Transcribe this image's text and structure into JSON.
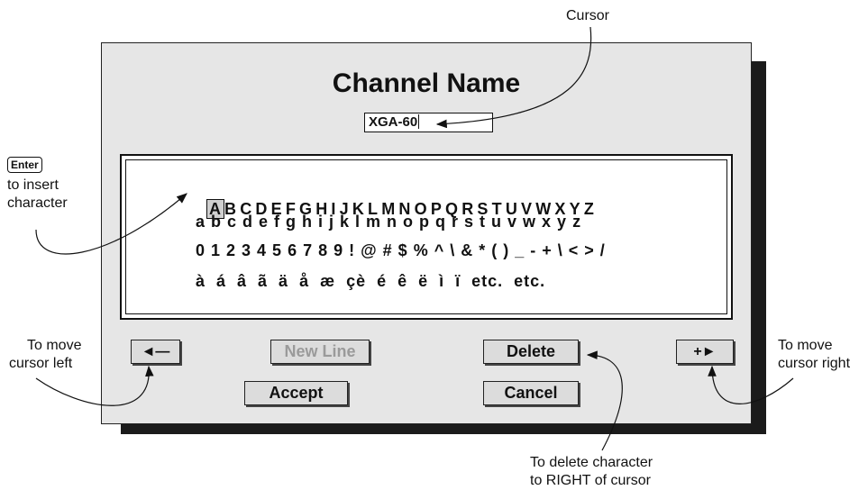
{
  "dialog": {
    "title": "Channel Name",
    "name_value": "XGA-60",
    "highlighted_char": "A",
    "rows": [
      "BCDEFGHIJKLMNOPQRSTUVWXYZ",
      "a b c d e f g h i j k l m n o p q r s t u v w x y z",
      "0 1 2 3 4 5 6 7 8 9 ! @ # $ % ^ \\ & * ( ) _ - + \\ < > /",
      "à  á  â  ã  ä  å  æ  çè  é  ê  ë  ì  ï  etc.  etc."
    ],
    "buttons": {
      "left_arrow": "◄—",
      "new_line": "New Line",
      "accept": "Accept",
      "delete": "Delete",
      "cancel": "Cancel",
      "right_arrow": "+►"
    }
  },
  "annotations": {
    "cursor": "Cursor",
    "enter_key": "Enter",
    "enter_line1": "to insert",
    "enter_line2": "character",
    "move_left_line1": "To move",
    "move_left_line2": "cursor left",
    "move_right_line1": "To move",
    "move_right_line2": "cursor right",
    "delete_line1": "To delete character",
    "delete_line2": "to RIGHT of cursor"
  }
}
